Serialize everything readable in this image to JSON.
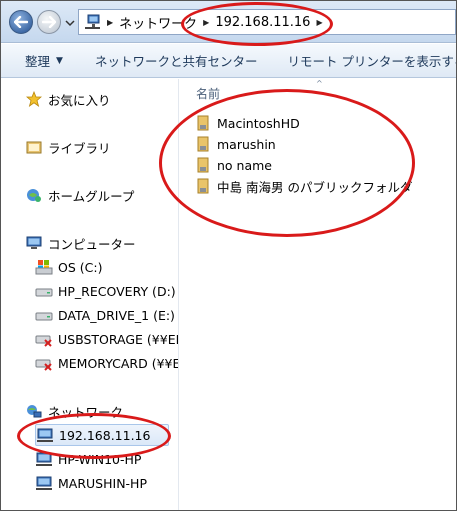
{
  "address": {
    "crumbs": [
      "ネットワーク",
      "192.168.11.16"
    ]
  },
  "toolbar": {
    "organize_label": "整理",
    "share_label": "ネットワークと共有センター",
    "remote_label": "リモート プリンターを表示する"
  },
  "sidebar": {
    "favorites": "お気に入り",
    "libraries": "ライブラリ",
    "homegroup": "ホームグループ",
    "computer": "コンピューター",
    "drives": [
      {
        "label": "OS (C:)",
        "icon": "os-drive-icon"
      },
      {
        "label": "HP_RECOVERY (D:)",
        "icon": "hard-drive-icon"
      },
      {
        "label": "DATA_DRIVE_1 (E:)",
        "icon": "hard-drive-icon"
      },
      {
        "label": "USBSTORAGE (¥¥EP",
        "icon": "disconnected-drive-icon"
      },
      {
        "label": "MEMORYCARD (¥¥El",
        "icon": "disconnected-drive-icon"
      }
    ],
    "network": "ネットワーク",
    "hosts": [
      {
        "label": "192.168.11.16",
        "selected": true
      },
      {
        "label": "HP-WIN10-HP",
        "selected": false
      },
      {
        "label": "MARUSHIN-HP",
        "selected": false
      }
    ]
  },
  "content": {
    "column_name": "名前",
    "items": [
      "MacintoshHD",
      "marushin",
      "no name",
      "中島 南海男 のパブリックフォルダ"
    ]
  },
  "colors": {
    "annotation": "#d91a1a",
    "toolbar_text": "#1e395b",
    "selection": "#dbe8f8"
  }
}
